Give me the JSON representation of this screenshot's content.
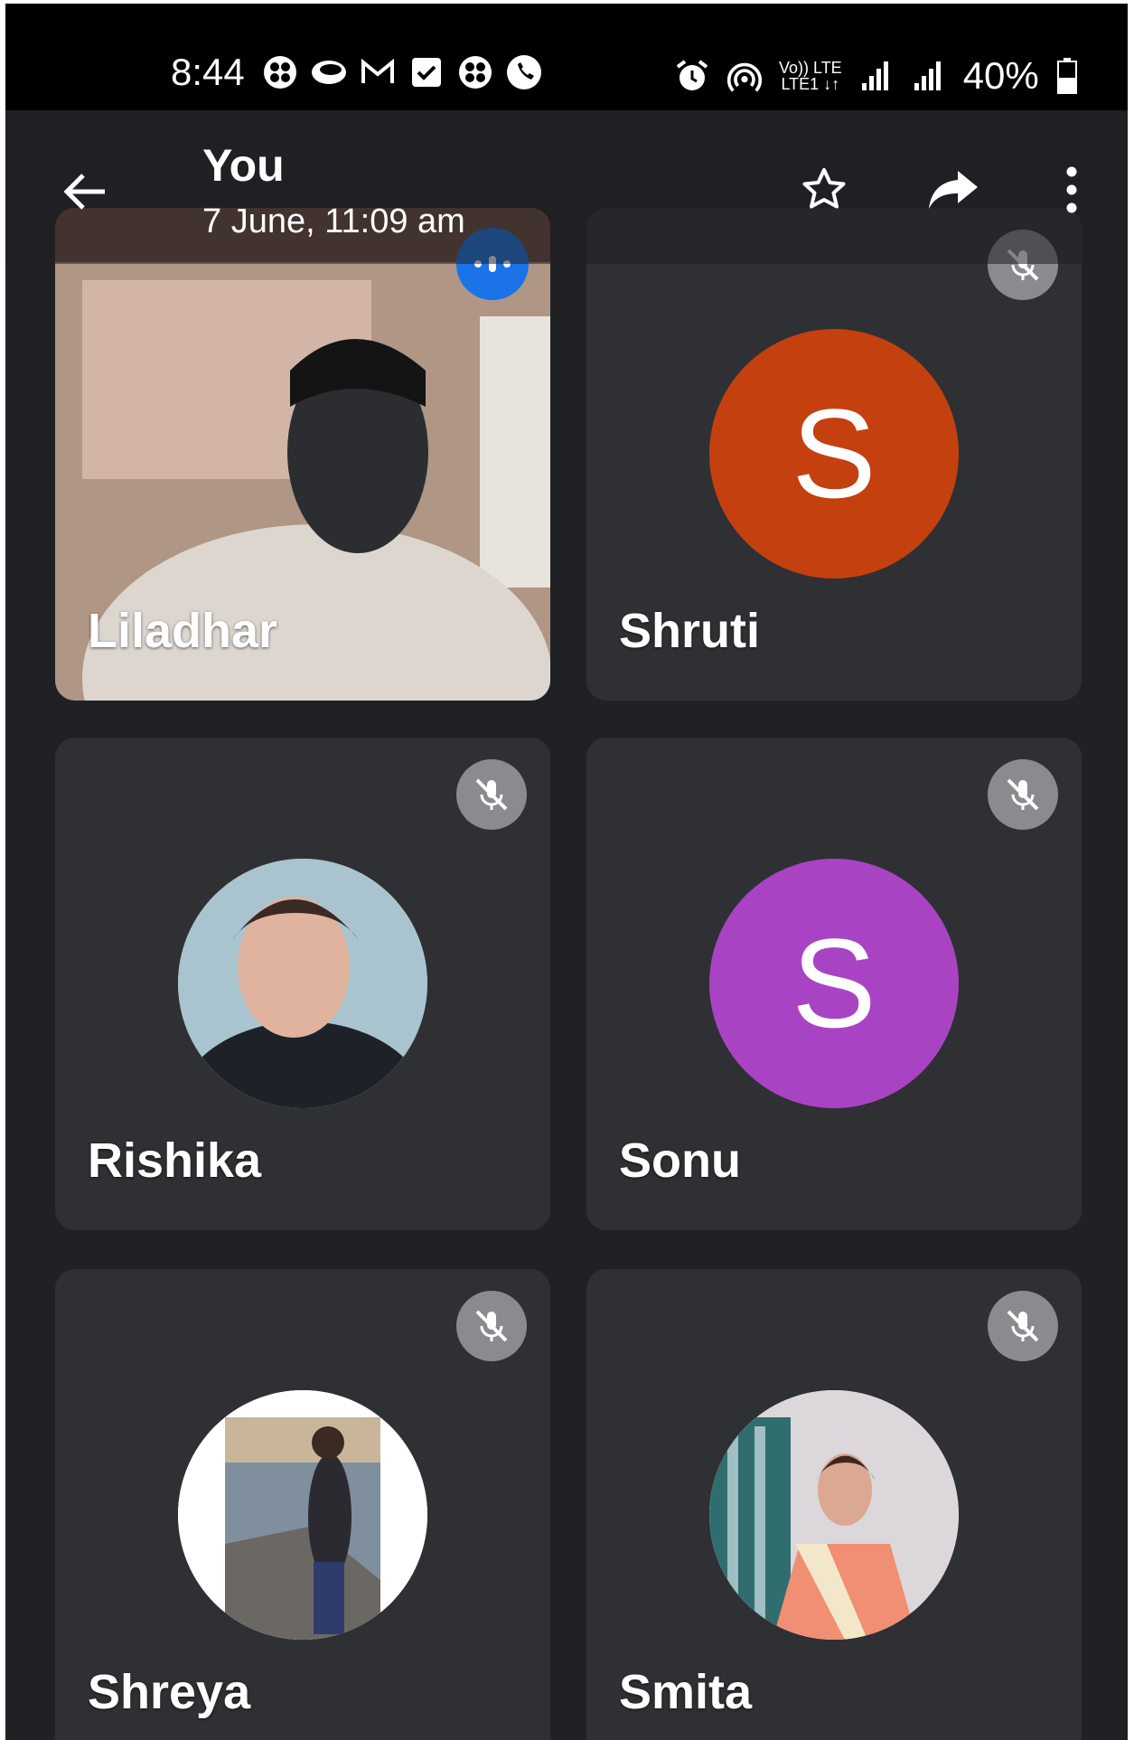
{
  "status_bar": {
    "time": "8:44",
    "battery": "40%",
    "network_top": "Vo)) LTE",
    "network_bottom": "LTE1 ↓↑",
    "icons_left": [
      "network-icon",
      "message-icon",
      "gmail-icon",
      "task-check-icon",
      "network-icon",
      "phone-icon"
    ],
    "icons_right": [
      "alarm-icon",
      "hotspot-icon",
      "signal-icon",
      "signal-icon",
      "battery-icon"
    ]
  },
  "header": {
    "title": "You",
    "subtitle": "7 June, 11:09 am"
  },
  "participants": [
    {
      "name": "Liladhar",
      "type": "video",
      "speaking": true
    },
    {
      "name": "Shruti",
      "type": "letter",
      "letter": "S",
      "color": "#c5400f",
      "muted": true
    },
    {
      "name": "Rishika",
      "type": "photo",
      "muted": true
    },
    {
      "name": "Sonu",
      "type": "letter",
      "letter": "S",
      "color": "#a844c4",
      "muted": true
    },
    {
      "name": "Shreya",
      "type": "photo",
      "muted": true
    },
    {
      "name": "Smita",
      "type": "photo",
      "muted": true
    }
  ],
  "colors": {
    "background": "#202124",
    "tile": "#2f3033",
    "speaking_indicator": "#1a73e8",
    "mute_badge": "#8a8b8e"
  }
}
